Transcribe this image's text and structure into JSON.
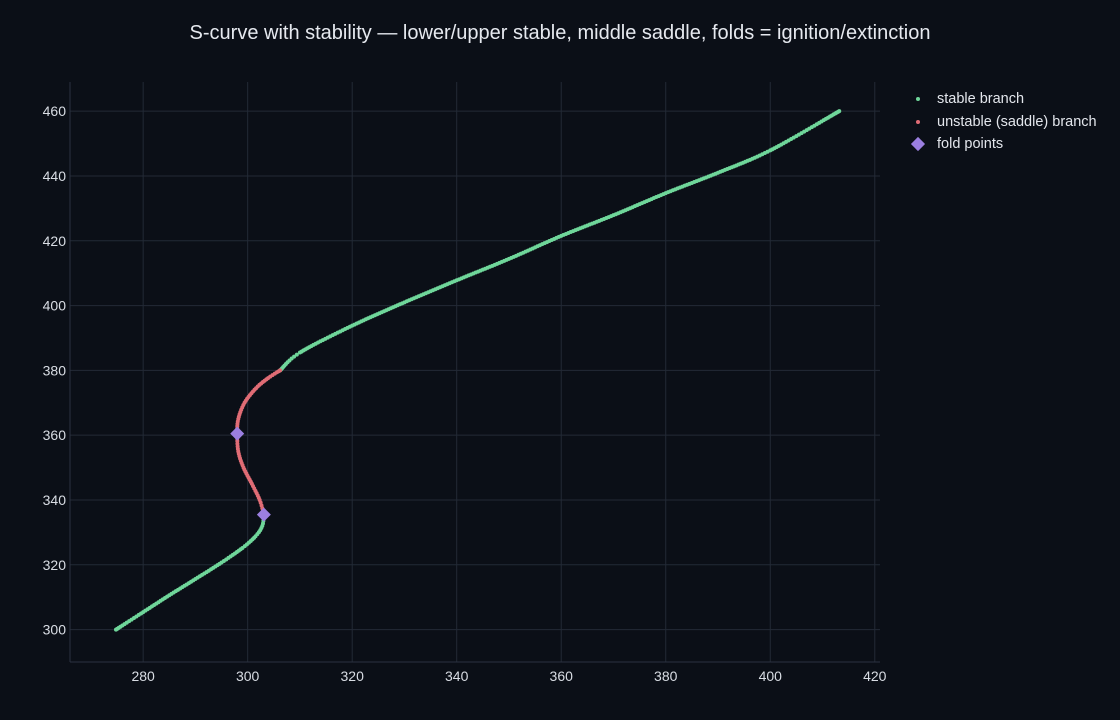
{
  "chart_data": {
    "type": "scatter",
    "title": "S-curve with stability — lower/upper stable, middle saddle, folds = ignition/extinction",
    "xlabel": "",
    "ylabel": "",
    "xlim": [
      266,
      421
    ],
    "ylim": [
      290,
      469
    ],
    "x_ticks": [
      280,
      300,
      320,
      340,
      360,
      380,
      400,
      420
    ],
    "y_ticks": [
      300,
      320,
      340,
      360,
      380,
      400,
      420,
      440,
      460
    ],
    "grid": true,
    "legend_position": "top-right",
    "series": [
      {
        "name": "stable branch",
        "color": "#6fd69a",
        "marker": "dot",
        "segments": [
          {
            "x": [
              274.8,
              280,
              285,
              290,
              295,
              299,
              301.5,
              302.8,
              303.1
            ],
            "y": [
              300,
              305.4,
              310.6,
              315.6,
              320.7,
              325.2,
              328.8,
              332.0,
              335.5
            ]
          },
          {
            "x": [
              306.2,
              310,
              320,
              330,
              340,
              350,
              360,
              370,
              380,
              390,
              400,
              413.2
            ],
            "y": [
              380,
              385.5,
              393.8,
              401.0,
              407.8,
              414.4,
              421.5,
              427.9,
              434.7,
              441.0,
              447.9,
              460
            ]
          }
        ]
      },
      {
        "name": "unstable (saddle) branch",
        "color": "#e06c75",
        "marker": "dot",
        "segments": [
          {
            "x": [
              303.1,
              302.3,
              300.8,
              299.2,
              298.2,
              298.0,
              298.2,
              299.4,
              301.6,
              303.9,
              306.2
            ],
            "y": [
              335.5,
              340.0,
              345.0,
              350.0,
              355.0,
              360.5,
              365.0,
              370.0,
              374.5,
              377.6,
              380.0
            ]
          }
        ]
      },
      {
        "name": "fold points",
        "color": "#9b7fe0",
        "marker": "diamond",
        "points": [
          {
            "x": 298.0,
            "y": 360.5
          },
          {
            "x": 303.1,
            "y": 335.5
          }
        ]
      }
    ]
  }
}
